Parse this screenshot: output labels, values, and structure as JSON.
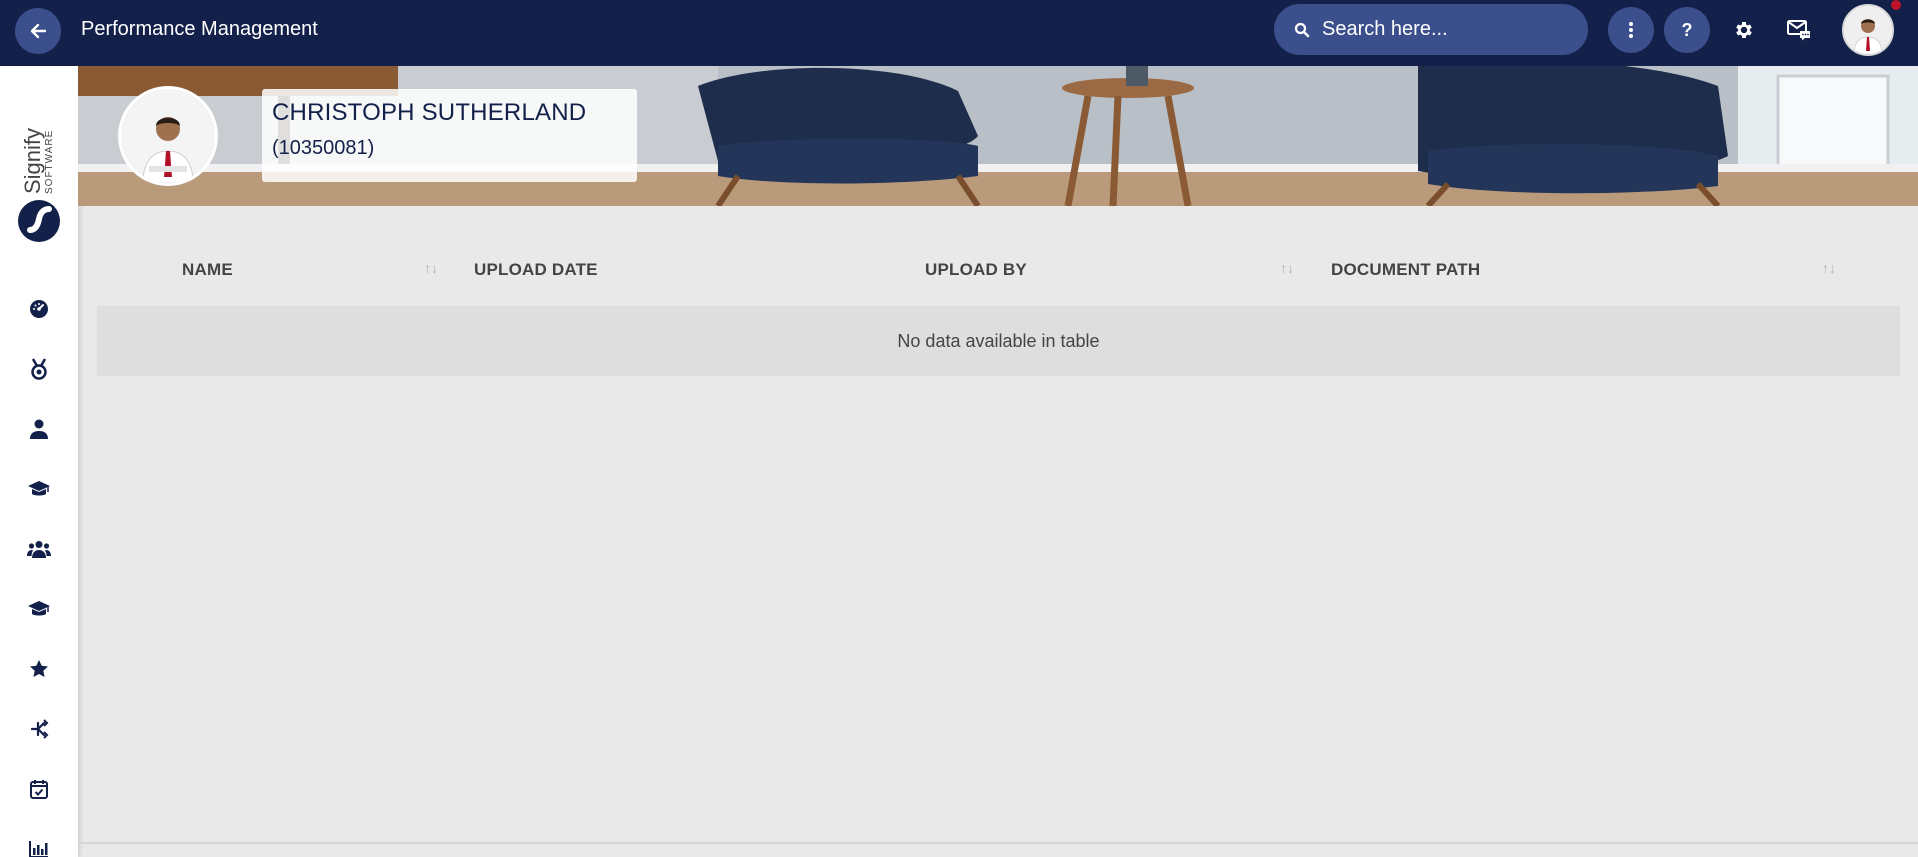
{
  "header": {
    "title": "Performance Management",
    "search_placeholder": "Search here..."
  },
  "sidebar": {
    "logo_line1": "Signify",
    "logo_line2": "SOFTWARE",
    "items": [
      {
        "icon": "dashboard-icon"
      },
      {
        "icon": "medal-icon"
      },
      {
        "icon": "person-icon"
      },
      {
        "icon": "graduation-cap-icon"
      },
      {
        "icon": "team-icon"
      },
      {
        "icon": "graduation-cap-icon"
      },
      {
        "icon": "star-icon"
      },
      {
        "icon": "hierarchy-icon"
      },
      {
        "icon": "calendar-check-icon"
      },
      {
        "icon": "bar-chart-icon"
      }
    ]
  },
  "profile": {
    "name": "CHRISTOPH SUTHERLAND",
    "employee_id": "(10350081)"
  },
  "table": {
    "columns": [
      "NAME",
      "UPLOAD DATE",
      "UPLOAD BY",
      "DOCUMENT PATH"
    ],
    "empty_message": "No data available in table"
  },
  "colors": {
    "navbar": "#13204a",
    "button": "#3b4f8c",
    "notification": "#c0132b"
  }
}
